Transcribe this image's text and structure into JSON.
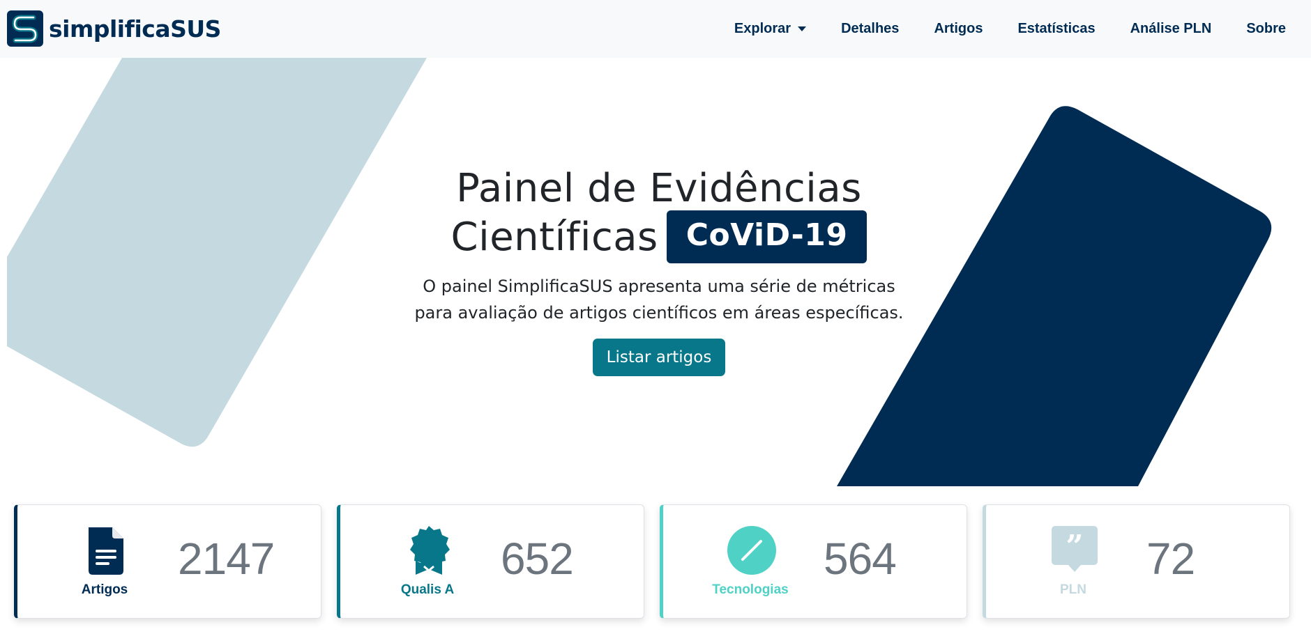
{
  "navbar": {
    "brand": "simplificaSUS",
    "items": [
      {
        "label": "Explorar",
        "has_dropdown": true
      },
      {
        "label": "Detalhes"
      },
      {
        "label": "Artigos"
      },
      {
        "label": "Estatísticas"
      },
      {
        "label": "Análise PLN"
      },
      {
        "label": "Sobre"
      }
    ]
  },
  "hero": {
    "title_line1": "Painel de Evidências",
    "title_line2": "Científicas",
    "badge": "CoViD-19",
    "description": "O painel SimplificaSUS apresenta uma série de métricas para avaliação de artigos científicos em áreas específicas.",
    "button_label": "Listar artigos"
  },
  "cards": [
    {
      "label": "Artigos",
      "value": "2147",
      "icon": "document-icon",
      "color": "#002c54"
    },
    {
      "label": "Qualis A",
      "value": "652",
      "icon": "award-icon",
      "color": "#08778a"
    },
    {
      "label": "Tecnologias",
      "value": "564",
      "icon": "slash-circle-icon",
      "color": "#4fd1c5"
    },
    {
      "label": "PLN",
      "value": "72",
      "icon": "quote-icon",
      "color": "#c5d9e0"
    }
  ],
  "colors": {
    "navy": "#002c54",
    "teal": "#08778a",
    "turquoise": "#4fd1c5",
    "light_blue": "#c5d9e0",
    "navbar_bg": "#f8f9fa"
  }
}
